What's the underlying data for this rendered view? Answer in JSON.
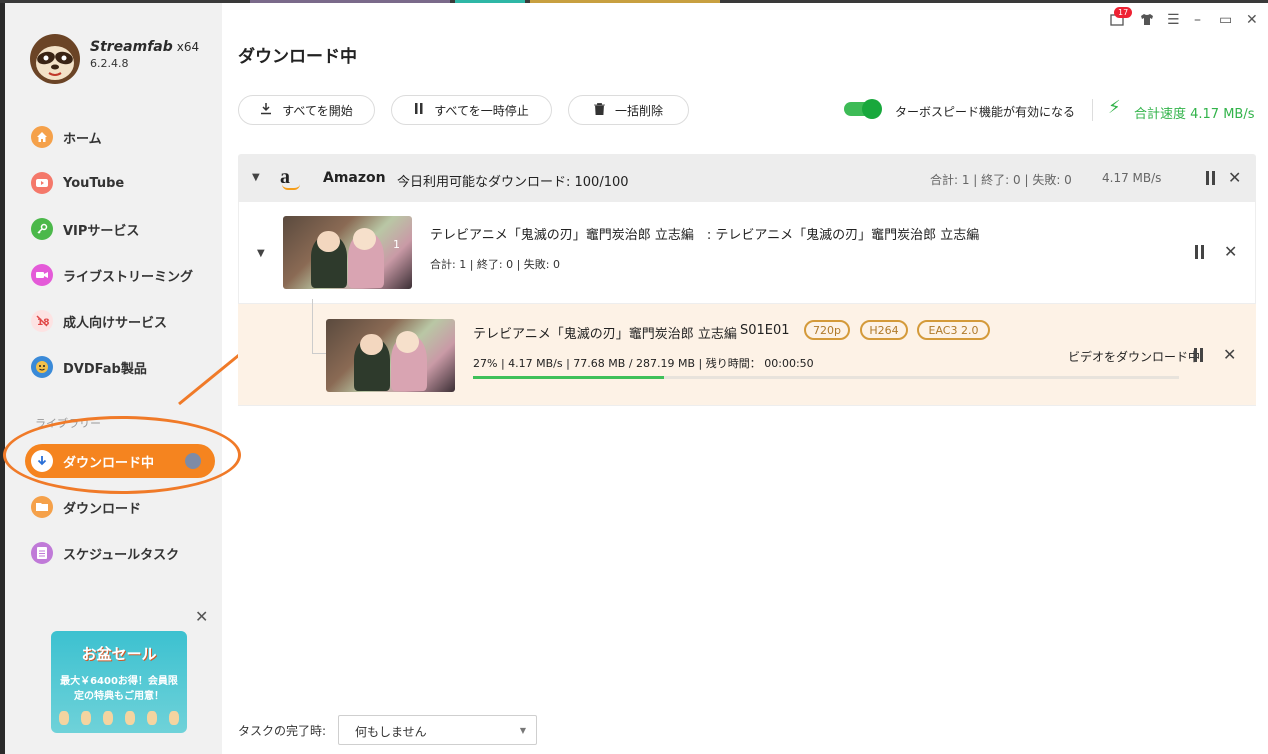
{
  "app": {
    "brand": "Streamfab",
    "arch": "x64",
    "version": "6.2.4.8",
    "notif_count": "17"
  },
  "sidebar": {
    "items": [
      {
        "label": "ホーム",
        "icon": "home-icon",
        "color": "#f5a14a"
      },
      {
        "label": "YouTube",
        "icon": "youtube-icon",
        "color": "#f4786a"
      },
      {
        "label": "VIPサービス",
        "icon": "key-icon",
        "color": "#4bb84a"
      },
      {
        "label": "ライブストリーミング",
        "icon": "camera-icon",
        "color": "#e45ad8"
      },
      {
        "label": "成人向けサービス",
        "icon": "adult-block-icon",
        "color": "#f46a6a"
      },
      {
        "label": "DVDFab製品",
        "icon": "dvdfab-icon",
        "color": "#3a8ad8"
      }
    ],
    "library_label": "ライブラリー",
    "library": [
      {
        "label": "ダウンロード中",
        "icon": "download-arrow-icon",
        "active": true
      },
      {
        "label": "ダウンロード",
        "icon": "folder-icon",
        "color": "#f5a14a"
      },
      {
        "label": "スケジュールタスク",
        "icon": "schedule-list-icon",
        "color": "#c07ad8"
      }
    ],
    "promo": {
      "title": "お盆セール",
      "line1": "最大￥6400お得！会員限",
      "line2": "定の特典もご用意！"
    }
  },
  "main": {
    "title": "ダウンロード中",
    "toolbar": {
      "start_all": "すべてを開始",
      "pause_all": "すべてを一時停止",
      "delete_all": "一括削除"
    },
    "turbo_label": "ターボスピード機能が有効になる",
    "total_speed": "合計速度 4.17 MB/s",
    "group": {
      "logo": "a",
      "name": "Amazon",
      "quota": "今日利用可能なダウンロード: 100/100",
      "stats": "合計: 1 | 終了: 0 | 失敗: 0",
      "speed": "4.17 MB/s"
    },
    "show": {
      "title": "テレビアニメ「鬼滅の刃」竈門炭治郎 立志編　: テレビアニメ「鬼滅の刃」竈門炭治郎 立志編",
      "stats": "合計: 1  |  終了: 0  |  失敗: 0",
      "count": "1"
    },
    "episode": {
      "title": "テレビアニメ「鬼滅の刃」竈門炭治郎 立志編",
      "ep": "S01E01",
      "tags": [
        "720p",
        "H264",
        "EAC3 2.0"
      ],
      "progress_text": "27%  |  4.17 MB/s  |  77.68 MB / 287.19 MB  |  残り時間：  00:00:50",
      "progress": 0.27,
      "state": "ビデオをダウンロード中"
    },
    "footer": {
      "label": "タスクの完了時:",
      "select_value": "何もしません"
    }
  },
  "colors": {
    "accent": "#f5841f",
    "green": "#32b34a",
    "tag": "#d49a3a"
  }
}
